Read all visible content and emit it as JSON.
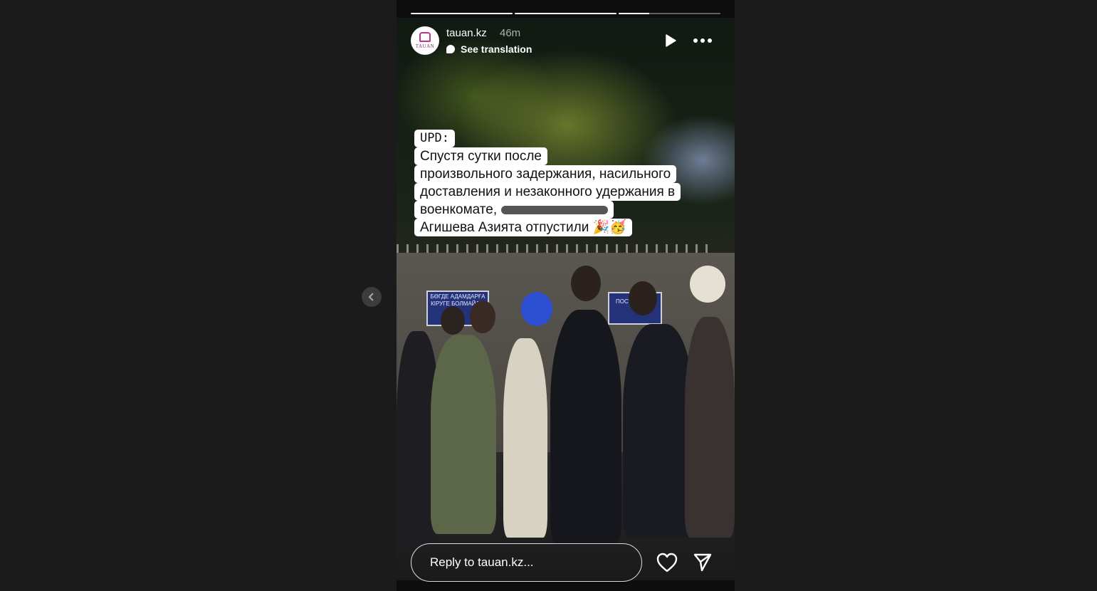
{
  "story": {
    "username": "tauan.kz",
    "time": "46m",
    "see_translation": "See translation",
    "avatar_text": "TAUAN",
    "progress": [
      1.0,
      1.0,
      0.3
    ]
  },
  "caption": {
    "upd": "UPD:",
    "line1": "Спустя сутки после",
    "line2": "произвольного задержания, насильного",
    "line3": "доставления и незаконного удержания в",
    "line4": "военкомате,",
    "line5": "Агишева Азията отпустили 🎉🥳"
  },
  "photo_signs": {
    "left": "БӨГДЕ АДАМДАРҒА КІРУГЕ БОЛМАЙДЫ",
    "right": "ПОСТО... ЗА..."
  },
  "footer": {
    "reply_placeholder": "Reply to tauan.kz..."
  },
  "icons": {
    "play": "play-icon",
    "more": "more-icon",
    "heart": "heart-icon",
    "send": "send-icon",
    "prev": "chevron-left-icon"
  }
}
